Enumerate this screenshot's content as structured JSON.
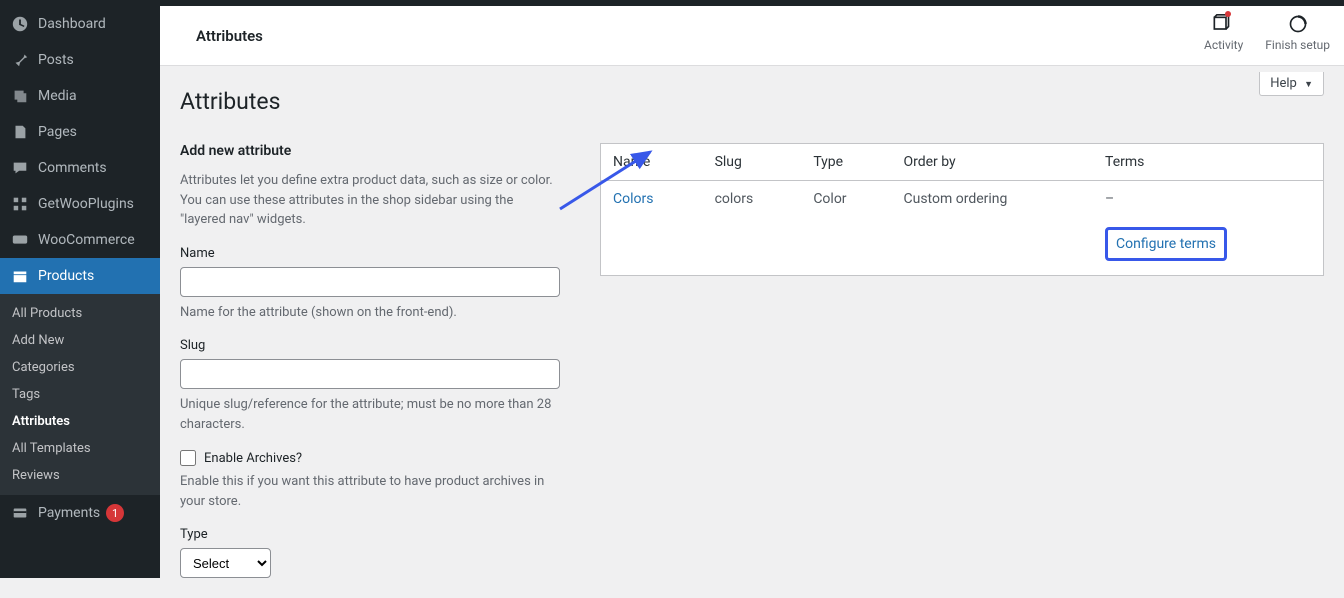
{
  "header": {
    "title": "Attributes",
    "activity": "Activity",
    "finish_setup": "Finish setup"
  },
  "help_label": "Help",
  "page_title": "Attributes",
  "sidebar": {
    "dashboard": "Dashboard",
    "posts": "Posts",
    "media": "Media",
    "pages": "Pages",
    "comments": "Comments",
    "getwooplugins": "GetWooPlugins",
    "woocommerce": "WooCommerce",
    "products": "Products",
    "payments": "Payments",
    "payments_badge": "1",
    "submenu": {
      "all_products": "All Products",
      "add_new": "Add New",
      "categories": "Categories",
      "tags": "Tags",
      "attributes": "Attributes",
      "all_templates": "All Templates",
      "reviews": "Reviews"
    }
  },
  "form": {
    "heading": "Add new attribute",
    "intro": "Attributes let you define extra product data, such as size or color. You can use these attributes in the shop sidebar using the \"layered nav\" widgets.",
    "name_label": "Name",
    "name_desc": "Name for the attribute (shown on the front-end).",
    "slug_label": "Slug",
    "slug_desc": "Unique slug/reference for the attribute; must be no more than 28 characters.",
    "archives_label": "Enable Archives?",
    "archives_desc": "Enable this if you want this attribute to have product archives in your store.",
    "type_label": "Type",
    "type_select": "Select"
  },
  "table": {
    "cols": {
      "name": "Name",
      "slug": "Slug",
      "type": "Type",
      "order_by": "Order by",
      "terms": "Terms"
    },
    "rows": [
      {
        "name": "Colors",
        "slug": "colors",
        "type": "Color",
        "order_by": "Custom ordering",
        "terms": "–"
      }
    ],
    "configure_terms": "Configure terms"
  }
}
